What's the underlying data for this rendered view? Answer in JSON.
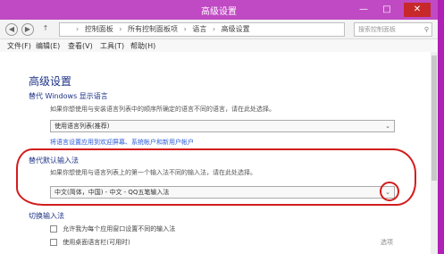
{
  "window": {
    "title": "高级设置",
    "minimize_glyph": "—",
    "maximize_glyph": "□",
    "close_glyph": "✕"
  },
  "nav": {
    "back_glyph": "◀",
    "forward_glyph": "▶",
    "up_glyph": "↑"
  },
  "address": {
    "crumbs": [
      "控制面板",
      "所有控制面板项",
      "语言",
      "高级设置"
    ],
    "search_placeholder": "搜索控制面板",
    "search_glyph": "⚲"
  },
  "menu": {
    "items": [
      "文件(F)",
      "编辑(E)",
      "查看(V)",
      "工具(T)",
      "帮助(H)"
    ]
  },
  "page": {
    "title": "高级设置",
    "display_language": {
      "heading": "替代 Windows 显示语言",
      "description": "如果你想使用与安装语言列表中的顺序所确定的语言不同的语言，请在此处选择。",
      "dropdown_value": "使用语言列表(推荐)",
      "dropdown_arrow": "⌄",
      "links": [
        "将语言设置应用到欢迎屏幕、系统帐户和新用户帐户"
      ]
    },
    "default_input": {
      "heading": "替代默认输入法",
      "description": "如果你想使用与语言列表上的第一个输入法不同的输入法，请在此处选择。",
      "dropdown_value": "中文(简体，中国) - 中文 - QQ五笔输入法",
      "dropdown_arrow": "⌄"
    },
    "switch_input": {
      "heading": "切换输入法",
      "checkbox1": "允许我为每个应用窗口设置不同的输入法",
      "checkbox2": "使用桌面语言栏(可用时)",
      "options_link": "选项"
    }
  },
  "colors": {
    "titlebar": "#c04ac3",
    "annotation": "#d21d1d",
    "link": "#2a5bd6",
    "heading": "#1e3287"
  }
}
